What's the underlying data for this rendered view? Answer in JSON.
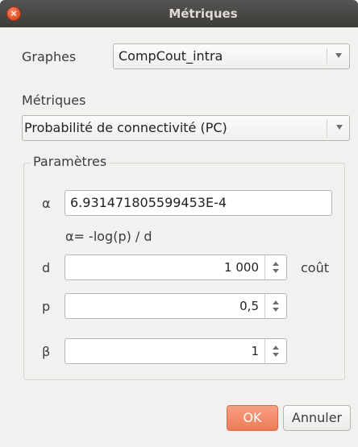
{
  "window": {
    "title": "Métriques"
  },
  "graphes": {
    "label": "Graphes",
    "value": "CompCout_intra"
  },
  "metriques": {
    "label": "Métriques",
    "value": "Probabilité de connectivité (PC)"
  },
  "parametres": {
    "title": "Paramètres",
    "alpha": {
      "label": "α",
      "value": "6.931471805599453E-4",
      "formula": "α= -log(p) / d"
    },
    "d": {
      "label": "d",
      "value": "1 000",
      "unit": "coût"
    },
    "p": {
      "label": "p",
      "value": "0,5"
    },
    "beta": {
      "label": "β",
      "value": "1"
    }
  },
  "buttons": {
    "ok": "OK",
    "cancel": "Annuler"
  }
}
